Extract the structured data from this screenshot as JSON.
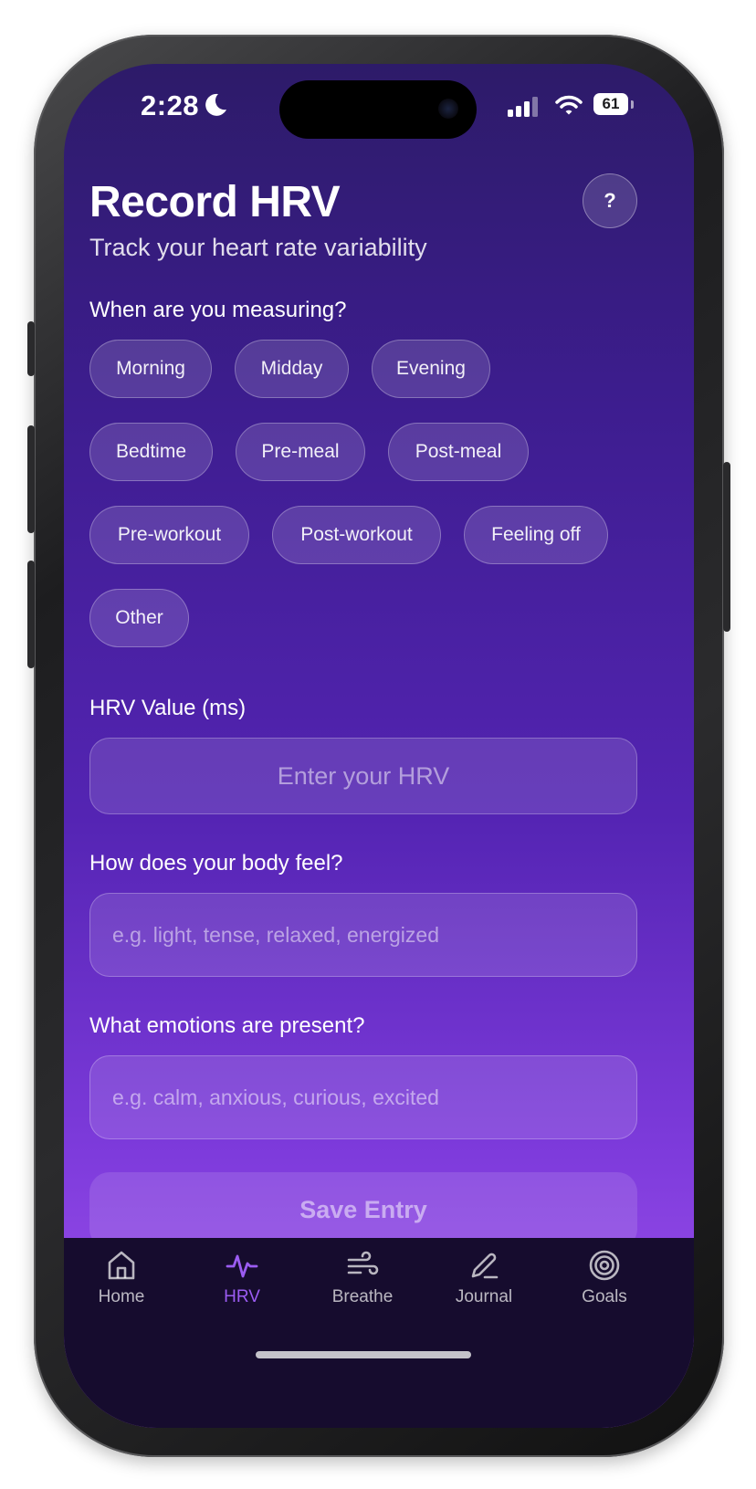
{
  "status_bar": {
    "time": "2:28",
    "battery": "61"
  },
  "header": {
    "title": "Record HRV",
    "subtitle": "Track your heart rate variability",
    "help_label": "?"
  },
  "timing": {
    "label": "When are you measuring?",
    "options": [
      "Morning",
      "Midday",
      "Evening",
      "Bedtime",
      "Pre-meal",
      "Post-meal",
      "Pre-workout",
      "Post-workout",
      "Feeling off",
      "Other"
    ]
  },
  "hrv": {
    "label": "HRV Value (ms)",
    "placeholder": "Enter your HRV"
  },
  "body": {
    "label": "How does your body feel?",
    "placeholder": "e.g. light, tense, relaxed, energized"
  },
  "emotions": {
    "label": "What emotions are present?",
    "placeholder": "e.g. calm, anxious, curious, excited"
  },
  "save_label": "Save Entry",
  "tabs": [
    {
      "label": "Home",
      "icon": "home-icon"
    },
    {
      "label": "HRV",
      "icon": "pulse-icon"
    },
    {
      "label": "Breathe",
      "icon": "wind-icon"
    },
    {
      "label": "Journal",
      "icon": "pen-icon"
    },
    {
      "label": "Goals",
      "icon": "target-icon"
    }
  ],
  "colors": {
    "accent": "#9b5cf2",
    "tab_bar_bg": "#160c2e"
  }
}
